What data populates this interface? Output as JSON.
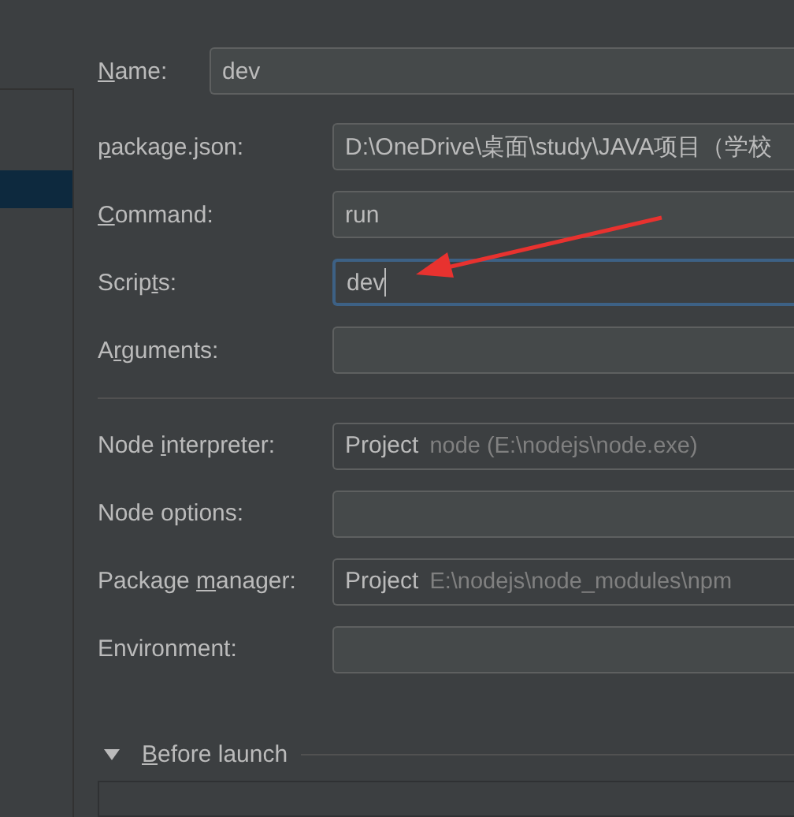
{
  "sidebar": {
    "rows": [
      {
        "selected": false
      },
      {
        "selected": true
      }
    ]
  },
  "name": {
    "label_parts": {
      "key": "N",
      "after": "ame:"
    },
    "value": "dev"
  },
  "fields": [
    {
      "label_parts": {
        "key": "p",
        "after": "ackage.json:"
      },
      "kind": "text",
      "value": "D:\\OneDrive\\桌面\\study\\JAVA项目（学校",
      "focused": false
    },
    {
      "label_parts": {
        "key": "C",
        "after": "ommand:"
      },
      "kind": "text",
      "value": "run",
      "focused": false
    },
    {
      "label_parts": {
        "before": "Scrip",
        "key": "t",
        "after": "s:"
      },
      "kind": "text",
      "value": "dev",
      "focused": true
    },
    {
      "label_parts": {
        "before": "A",
        "key": "r",
        "after": "guments:"
      },
      "kind": "text",
      "focused": false
    }
  ],
  "node_fields": [
    {
      "label_parts": {
        "before": "Node ",
        "key": "i",
        "after": "nterpreter:"
      },
      "kind": "combo",
      "prefix": "Project",
      "detail": "node (E:\\nodejs\\node.exe)",
      "focused": false
    },
    {
      "label": "Node options:",
      "kind": "text",
      "focused": false
    },
    {
      "label_parts": {
        "before": "Package ",
        "key": "m",
        "after": "anager:"
      },
      "kind": "combo",
      "prefix": "Project",
      "detail": "E:\\nodejs\\node_modules\\npm",
      "focused": false
    },
    {
      "label": "Environment:",
      "kind": "text",
      "focused": false
    }
  ],
  "before_launch": {
    "label_parts": {
      "key": "B",
      "after": "efore launch"
    },
    "expanded": true
  }
}
